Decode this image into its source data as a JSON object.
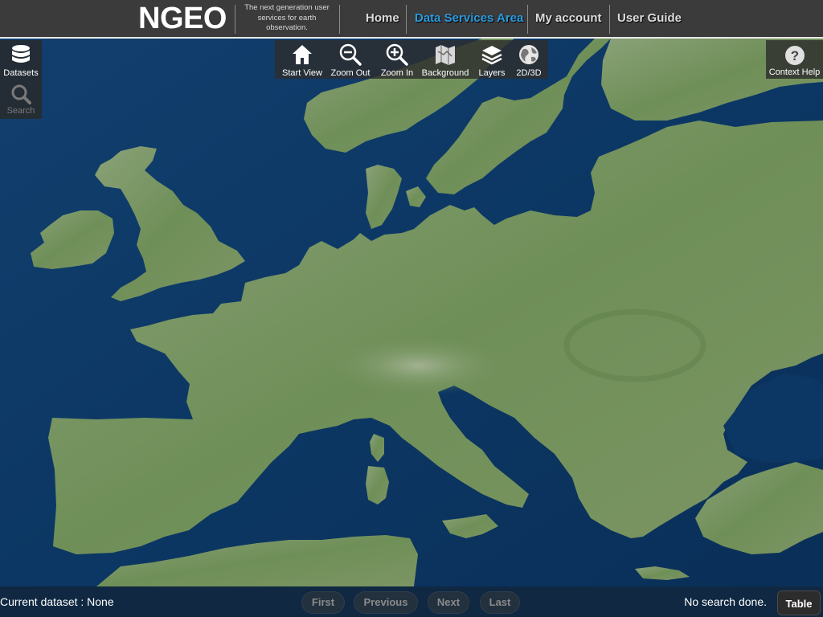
{
  "header": {
    "logo": "NGEO",
    "tagline": "The next generation user services for earth observation.",
    "nav": [
      {
        "label": "Home",
        "active": false
      },
      {
        "label": "Data Services Area",
        "active": true
      },
      {
        "label": "My account",
        "active": false
      },
      {
        "label": "User Guide",
        "active": false
      }
    ]
  },
  "left_panel": {
    "datasets": {
      "label": "Datasets",
      "icon": "database-icon"
    },
    "search": {
      "label": "Search",
      "icon": "magnifier-icon",
      "disabled": true
    }
  },
  "map_toolbar": {
    "start_view": {
      "label": "Start View",
      "icon": "home-icon"
    },
    "zoom_out": {
      "label": "Zoom Out",
      "icon": "zoom-out-icon"
    },
    "zoom_in": {
      "label": "Zoom In",
      "icon": "zoom-in-icon"
    },
    "background": {
      "label": "Background",
      "icon": "map-icon"
    },
    "layers": {
      "label": "Layers",
      "icon": "layers-icon"
    },
    "view_mode": {
      "label": "2D/3D",
      "icon": "globe-icon"
    },
    "context_help": {
      "label": "Context Help",
      "icon": "question-icon"
    }
  },
  "bottom_bar": {
    "current_dataset": "Current dataset : None",
    "pagination": {
      "first": "First",
      "previous": "Previous",
      "next": "Next",
      "last": "Last"
    },
    "search_status": "No search done.",
    "table_label": "Table"
  },
  "colors": {
    "header_bg": "#3b3b3b",
    "active_nav": "#2b9be0",
    "sea": "#0d3a68",
    "land": "#6f8f58"
  }
}
